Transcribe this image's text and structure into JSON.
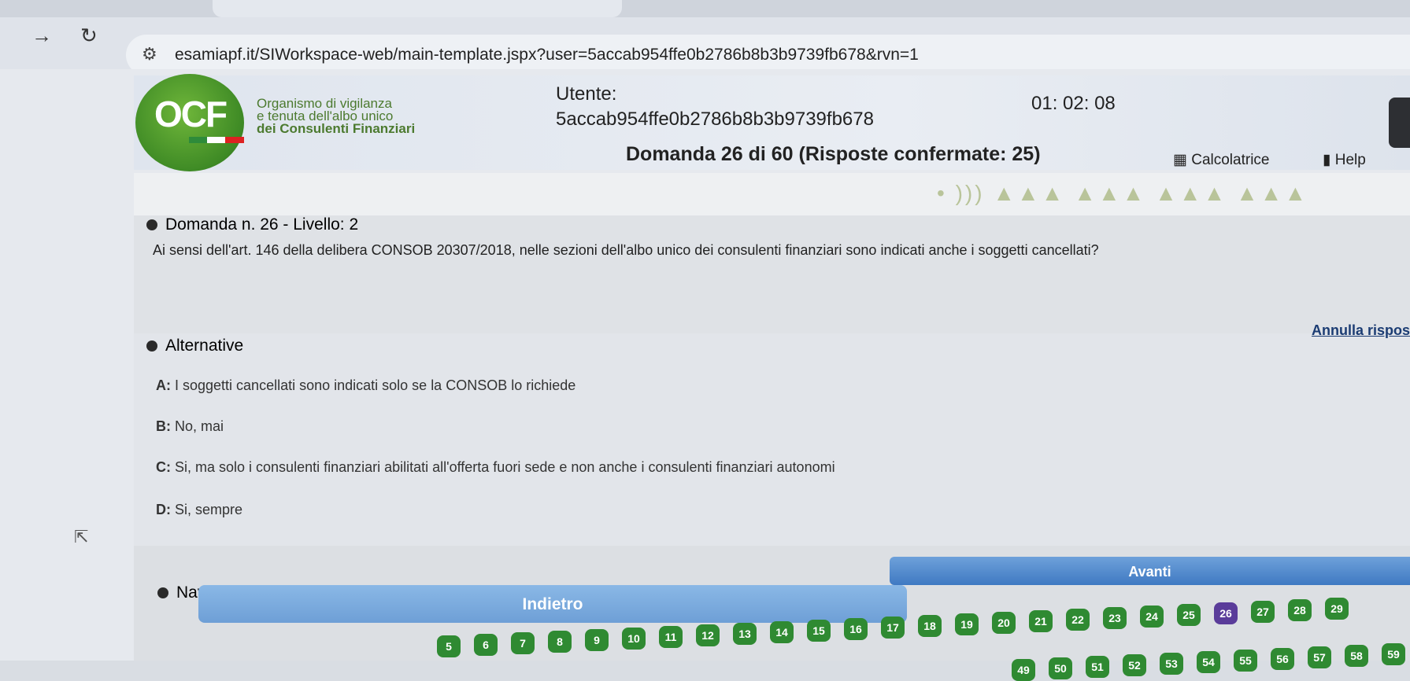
{
  "browser": {
    "url": "esamiapf.it/SIWorkspace-web/main-template.jspx?user=5accab954ffe0b2786b8b3b9739fb678&rvn=1"
  },
  "header": {
    "logo_text": "OCF",
    "org_line1": "Organismo di vigilanza",
    "org_line2": "e tenuta dell'albo unico",
    "org_line3": "dei Consulenti Finanziari",
    "user_label": "Utente:",
    "user_id": "5accab954ffe0b2786b8b3b9739fb678",
    "timer": "01: 02: 08",
    "question_status": "Domanda 26 di 60 (Risposte confermate: 25)",
    "calc_label": "Calcolatrice",
    "help_label": "Help"
  },
  "question": {
    "title": "Domanda n. 26 - Livello: 2",
    "text": "Ai sensi dell'art. 146 della delibera CONSOB 20307/2018, nelle sezioni dell'albo unico dei consulenti finanziari sono indicati anche i soggetti cancellati?"
  },
  "alternatives": {
    "title": "Alternative",
    "annulla": "Annulla rispos",
    "items": [
      {
        "key": "A:",
        "text": " I soggetti cancellati sono indicati solo se la CONSOB lo richiede"
      },
      {
        "key": "B:",
        "text": " No, mai"
      },
      {
        "key": "C:",
        "text": " Si, ma solo i consulenti finanziari abilitati all'offerta fuori sede e non anche i consulenti finanziari autonomi"
      },
      {
        "key": "D:",
        "text": " Si, sempre"
      }
    ]
  },
  "navigation": {
    "title": "Navigazione",
    "back_label": "Indietro",
    "next_label": "Avanti",
    "row1": [
      "5",
      "6",
      "7",
      "8",
      "9",
      "10",
      "11",
      "12",
      "13",
      "14",
      "15",
      "16",
      "17",
      "18",
      "19",
      "20",
      "21",
      "22",
      "23",
      "24",
      "25",
      "26",
      "27",
      "28",
      "29"
    ],
    "row2": [
      "49",
      "50",
      "51",
      "52",
      "53",
      "54",
      "55",
      "56",
      "57",
      "58",
      "59"
    ]
  },
  "colors": {
    "answered": "#2f8a32",
    "current": "#5a3c9a",
    "brand_green": "#3e8a25"
  }
}
